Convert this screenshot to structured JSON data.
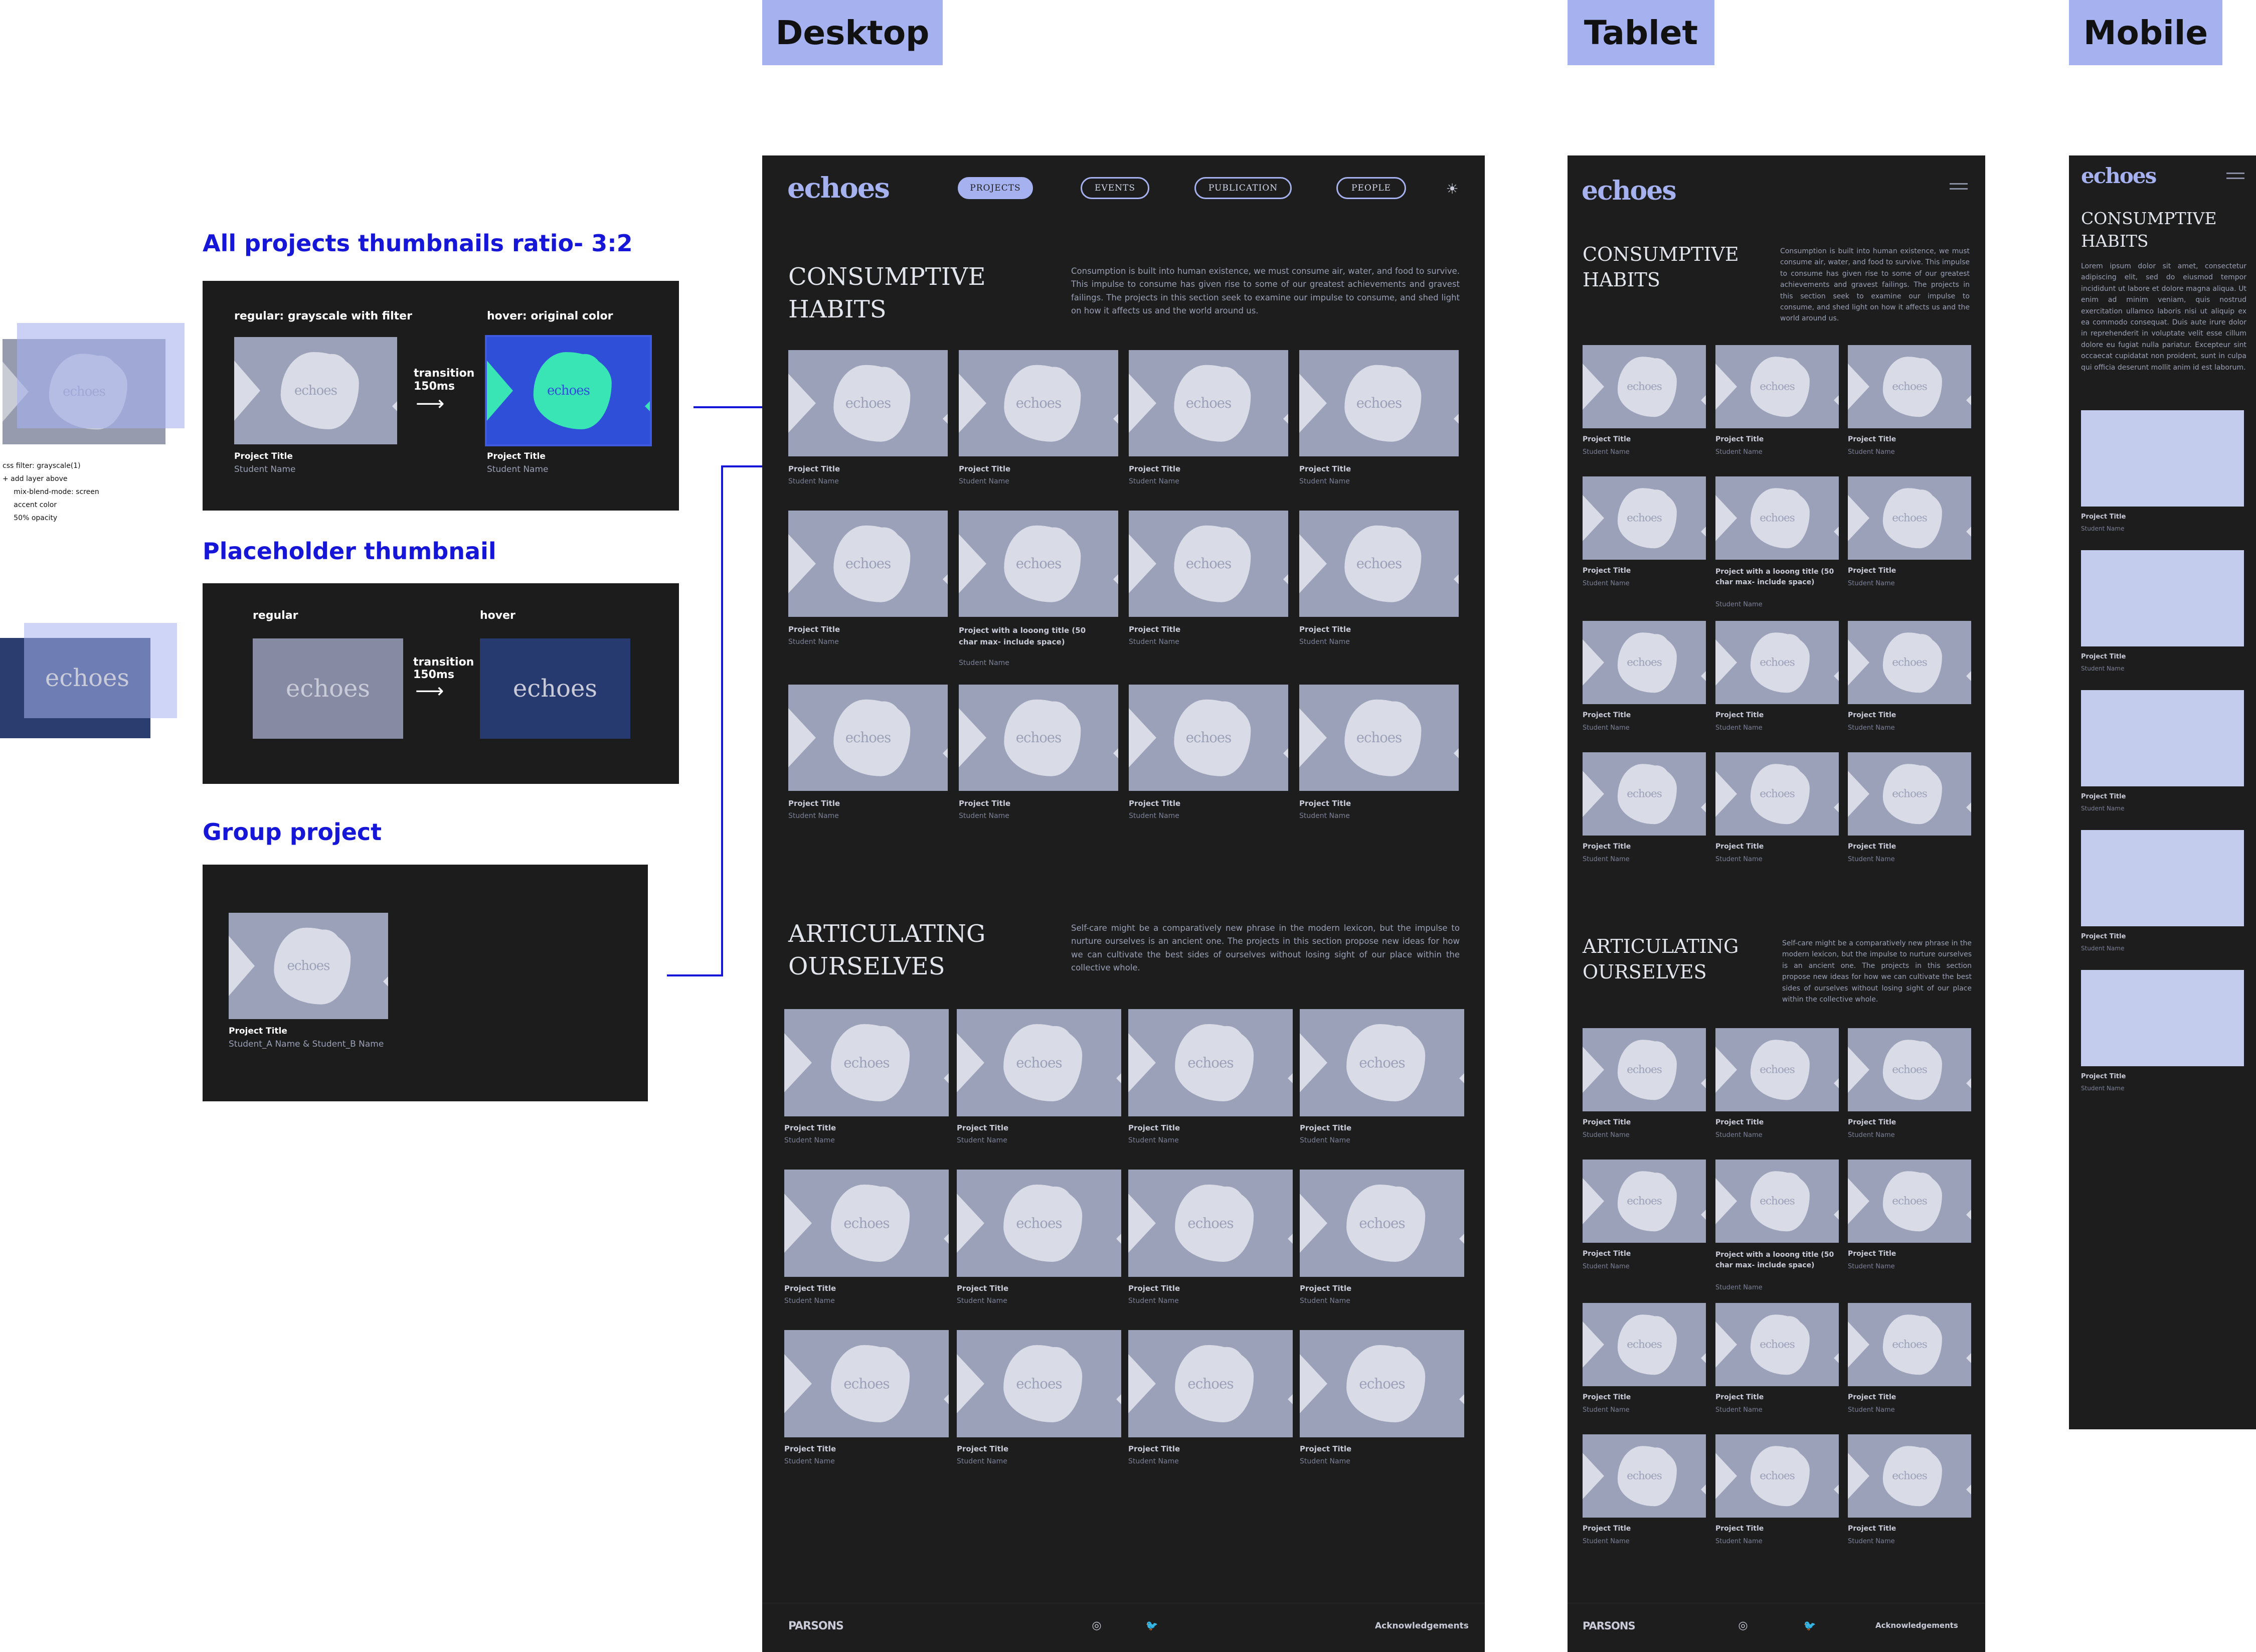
{
  "headers": {
    "desktop": "Desktop",
    "tablet": "Tablet",
    "mobile": "Mobile"
  },
  "annotations": {
    "thumb_ratio_title": "All projects thumbnails ratio- 3:2",
    "regular_label": "regular: grayscale with filter",
    "hover_label": "hover: original color",
    "transition": "transition",
    "transition_ms": "150ms",
    "arrow": "⟶",
    "project_title": "Project Title",
    "student_name": "Student Name",
    "css_note": "css filter: grayscale(1)\n+ add layer above\n     mix-blend-mode: screen\n     accent color\n     50% opacity",
    "placeholder_title": "Placeholder thumbnail",
    "ph_regular": "regular",
    "ph_hover": "hover",
    "group_title": "Group project",
    "group_student": "Student_A Name & Student_B Name"
  },
  "brand": {
    "logo": "echoes",
    "accent": "#a6b2ef",
    "bg": "#1d1d1d",
    "hover_bg": "#2f4fd8",
    "hover_fg": "#39e5b4"
  },
  "nav": {
    "projects": "PROJECTS",
    "events": "EVENTS",
    "publication": "PUBLICATION",
    "people": "PEOPLE",
    "theme_icon": "☀"
  },
  "sections": {
    "s1_title": "CONSUMPTIVE\nHABITS",
    "s1_desc": "Consumption is built into human existence, we must consume air, water, and food to survive. This impulse to consume has given rise to some of our greatest achievements and gravest failings. The projects in this section seek to examine our impulse to consume, and shed light on how it affects us and the world around us.",
    "s2_title": "ARTICULATING\nOURSELVES",
    "s2_desc": "Self-care might be a comparatively new phrase in the modern lexicon, but the impulse to nurture ourselves is an ancient one. The projects in this section propose new ideas for how we can cultivate the best sides of ourselves without losing sight of our place within the collective whole.",
    "mobile_desc": "Lorem ipsum dolor sit amet, consectetur adipiscing elit, sed do eiusmod tempor incididunt ut labore et dolore magna aliqua. Ut enim ad minim veniam, quis nostrud exercitation ullamco laboris nisi ut aliquip ex ea commodo consequat. Duis aute irure dolor in reprehenderit in voluptate velit esse cillum dolore eu fugiat nulla pariatur. Excepteur sint occaecat cupidatat non proident, sunt in culpa qui officia deserunt mollit anim id est laborum."
  },
  "long_title": "Project with a looong title (50 char max- include space)",
  "footer": {
    "brand": "PARSONS",
    "instagram_icon": "◎",
    "twitter_icon": "🐦",
    "acknowledgements": "Acknowledgements"
  }
}
